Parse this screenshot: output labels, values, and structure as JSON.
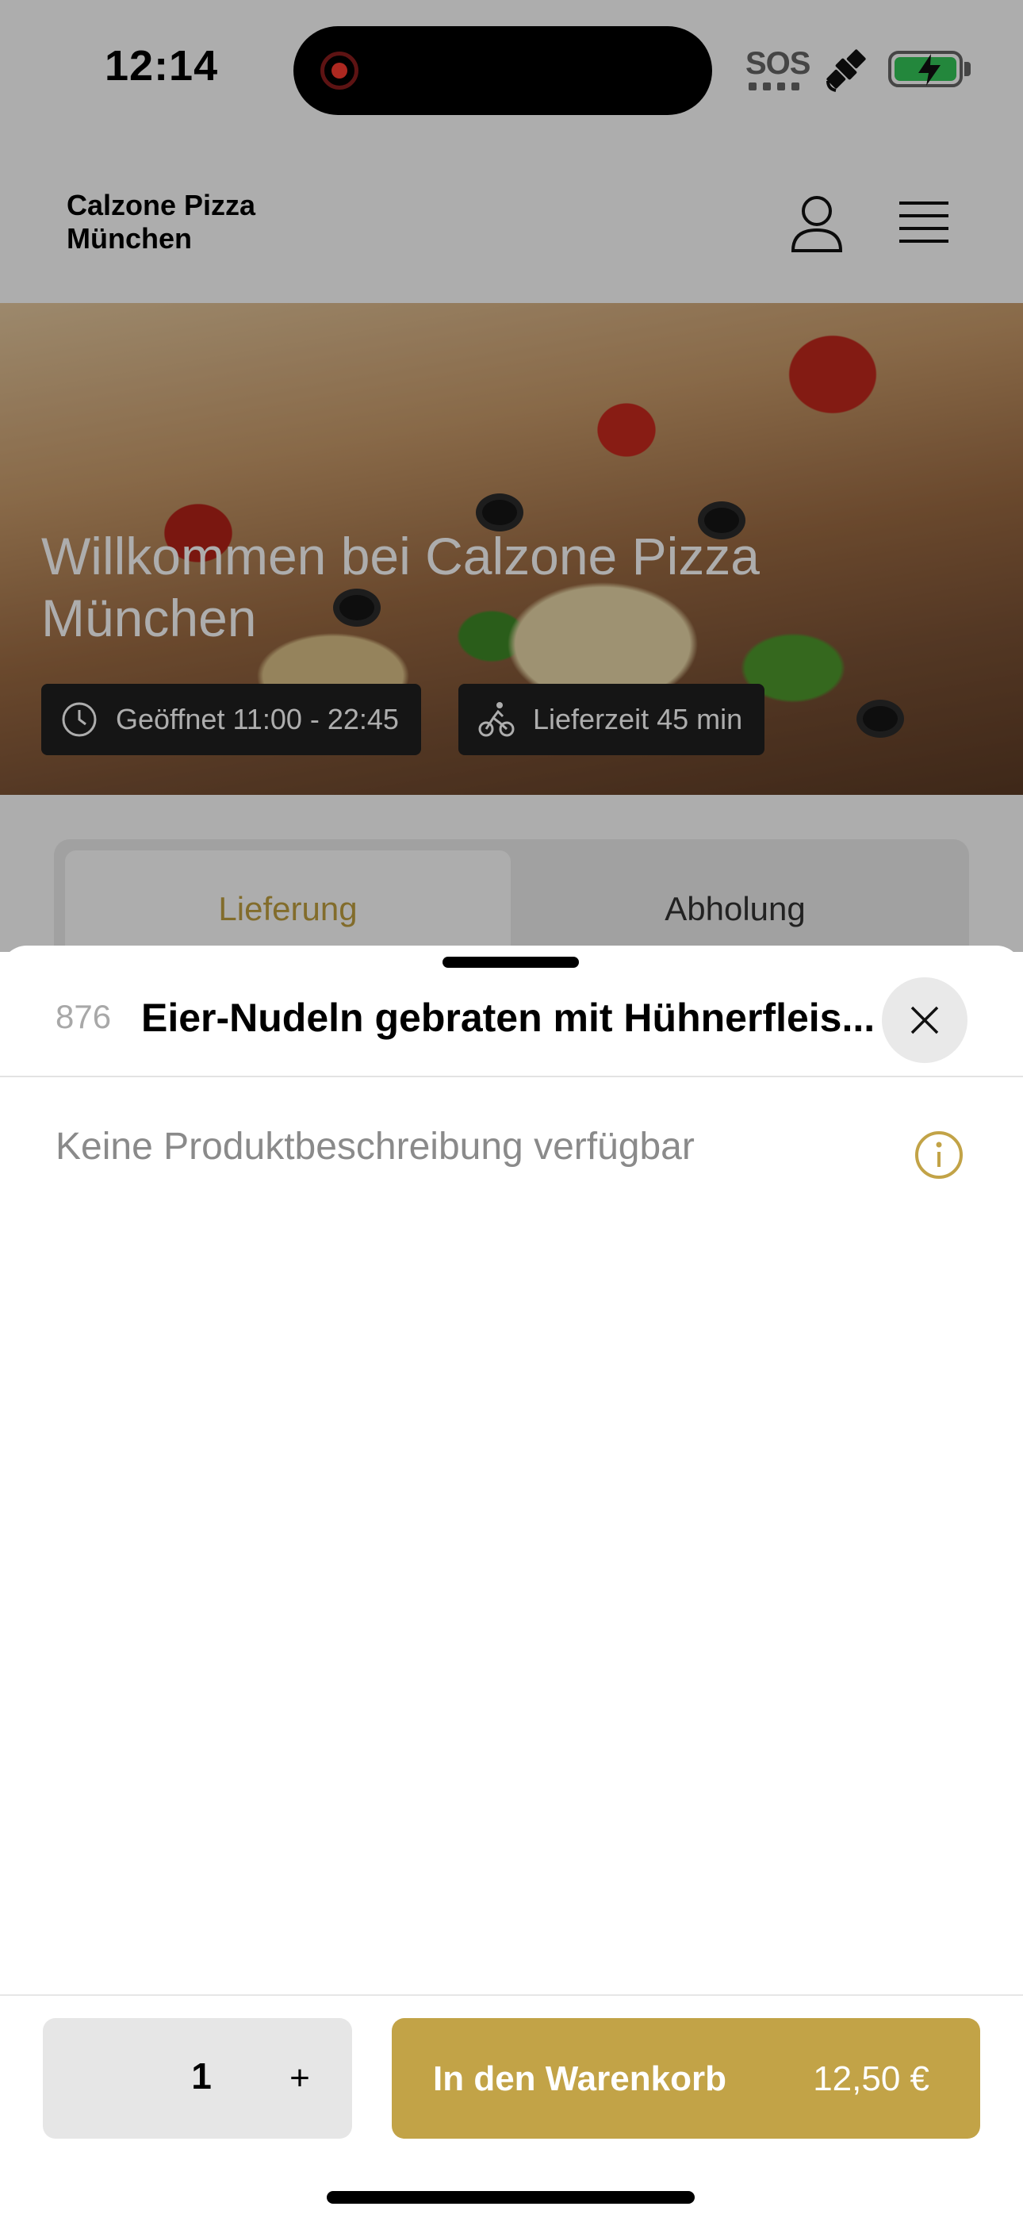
{
  "status_bar": {
    "time": "12:14",
    "sos": "SOS",
    "icons": [
      "screen-recording-icon",
      "satellite-icon",
      "battery-charging-icon"
    ]
  },
  "header": {
    "brand": "Calzone Pizza München",
    "icons": [
      "user-icon",
      "menu-icon"
    ]
  },
  "hero": {
    "title": "Willkommen bei Calzone Pizza München",
    "open_hours": "Geöffnet 11:00 - 22:45",
    "delivery_time": "Lieferzeit 45 min"
  },
  "order_mode": {
    "tabs": [
      {
        "label": "Lieferung",
        "active": true
      },
      {
        "label": "Abholung",
        "active": false
      }
    ]
  },
  "sheet": {
    "item_number": "876",
    "item_title": "Eier-Nudeln gebraten mit Hühnerfleis...",
    "description": "Keine Produktbeschreibung verfügbar",
    "quantity": "1",
    "plus_label": "+",
    "add_to_cart_label": "In den Warenkorb",
    "price": "12,50 €"
  },
  "colors": {
    "accent": "#c2a347",
    "accent_text": "#c0a040",
    "battery": "#34c759",
    "recording": "#ff3b30"
  }
}
